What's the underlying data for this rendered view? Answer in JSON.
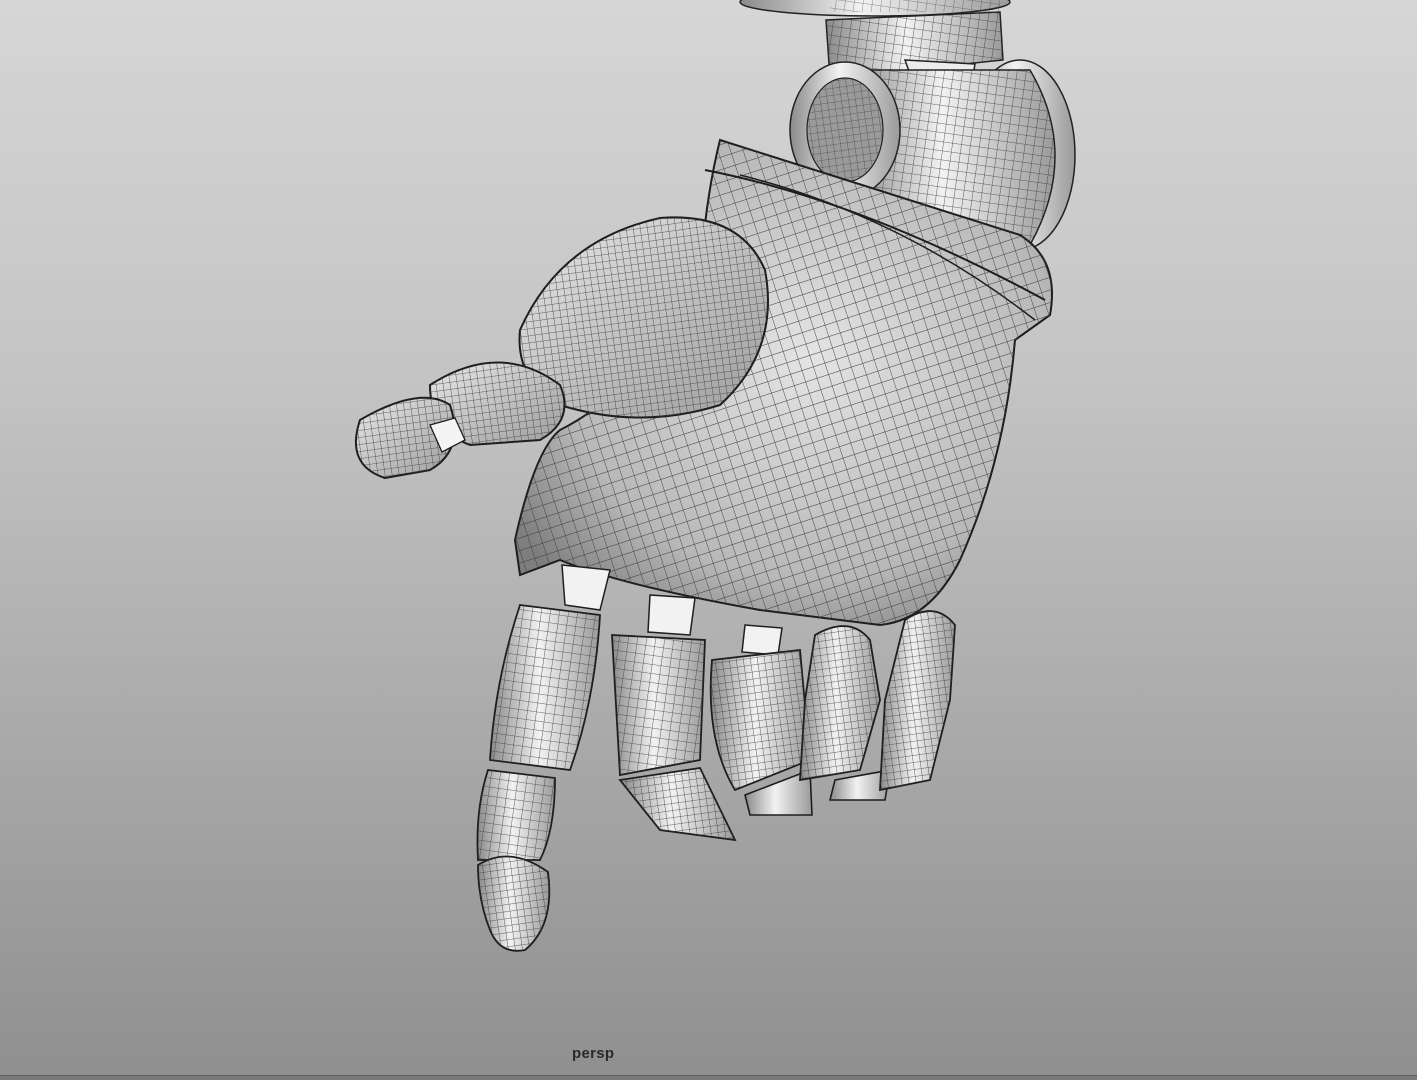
{
  "viewport": {
    "camera_label": "persp",
    "background_top": "#d6d6d6",
    "background_bottom": "#8f8f8f"
  },
  "scene": {
    "object": "robot-hand-mesh",
    "display_mode": "wireframe-on-shaded",
    "mesh_color": "#cfcfcf",
    "wire_color": "#3a3a3a"
  }
}
